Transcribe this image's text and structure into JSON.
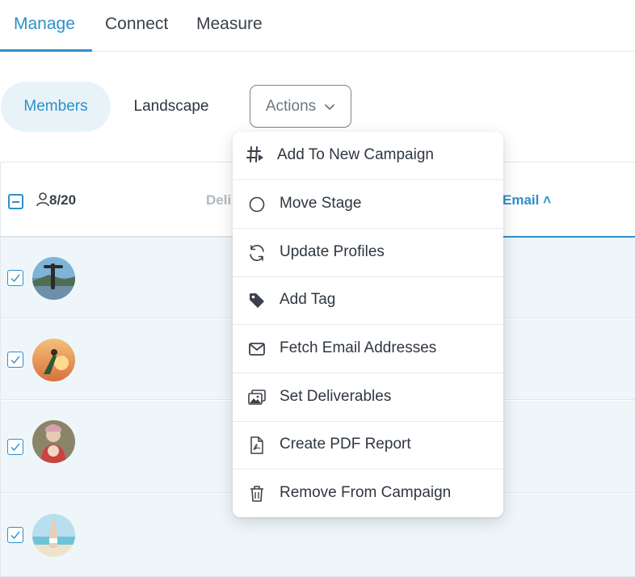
{
  "top_tabs": {
    "manage": "Manage",
    "connect": "Connect",
    "measure": "Measure"
  },
  "subnav": {
    "members": "Members",
    "landscape": "Landscape",
    "actions": "Actions"
  },
  "table": {
    "selected_count": "8/20",
    "col_deli": "Deli",
    "col_email": "Email ˄"
  },
  "menu": {
    "items": [
      {
        "label": "Add To New Campaign",
        "icon": "hashtag-icon"
      },
      {
        "label": "Move Stage",
        "icon": "circle-icon"
      },
      {
        "label": "Update Profiles",
        "icon": "refresh-icon"
      },
      {
        "label": "Add Tag",
        "icon": "tag-icon"
      },
      {
        "label": "Fetch Email Addresses",
        "icon": "envelope-icon"
      },
      {
        "label": "Set Deliverables",
        "icon": "images-icon"
      },
      {
        "label": "Create PDF Report",
        "icon": "pdf-file-icon"
      },
      {
        "label": "Remove From Campaign",
        "icon": "trash-icon"
      }
    ]
  },
  "colors": {
    "accent": "#2e90c9",
    "row_bg": "#eef6fa",
    "pill_bg": "#e8f3f8"
  }
}
